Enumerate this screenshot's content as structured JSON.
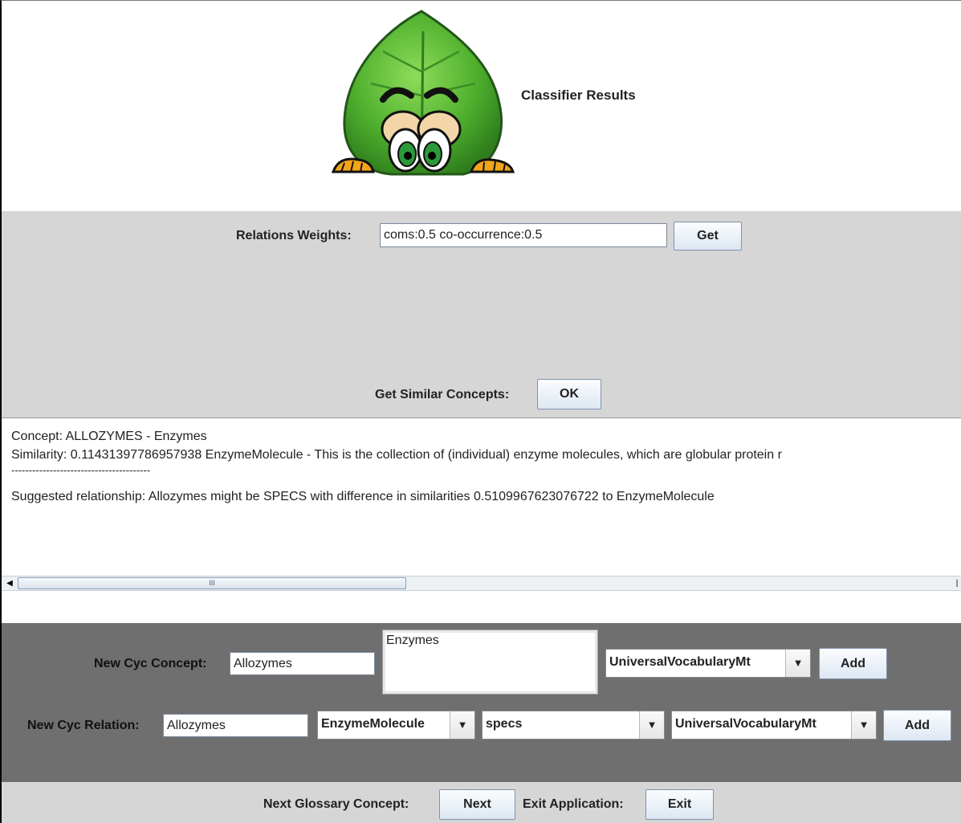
{
  "header": {
    "title": "Classifier Results"
  },
  "weights": {
    "label": "Relations Weights:",
    "value": "coms:0.5 co-occurrence:0.5",
    "get_button": "Get",
    "similar_label": "Get Similar Concepts:",
    "ok_button": "OK"
  },
  "results": {
    "lines": [
      "Concept: ALLOZYMES - Enzymes",
      "Similarity: 0.11431397786957938 EnzymeMolecule - This is the collection of (individual) enzyme molecules, which are globular protein r",
      "----------------------------------------",
      "Suggested relationship: Allozymes might be SPECS with difference in similarities 0.5109967623076722  to  EnzymeMolecule"
    ],
    "scroll_thumb_glyph": "III"
  },
  "cyc": {
    "concept_label": "New Cyc Concept:",
    "concept_value": "Allozymes",
    "concept_comment": "Enzymes",
    "concept_mt": "UniversalVocabularyMt",
    "concept_add": "Add",
    "relation_label": "New Cyc Relation:",
    "relation_value": "Allozymes",
    "relation_target": "EnzymeMolecule",
    "relation_type": "specs",
    "relation_mt": "UniversalVocabularyMt",
    "relation_add": "Add"
  },
  "footer": {
    "next_label": "Next Glossary Concept:",
    "next_button": "Next",
    "exit_label": "Exit Application:",
    "exit_button": "Exit"
  },
  "colors": {
    "leaf": "#5cb83a",
    "panel_light": "#d6d6d6",
    "panel_dark": "#6f6f6f"
  },
  "icons": {
    "logo": "leaf-mascot-icon",
    "dropdown": "chevron-down-icon"
  }
}
